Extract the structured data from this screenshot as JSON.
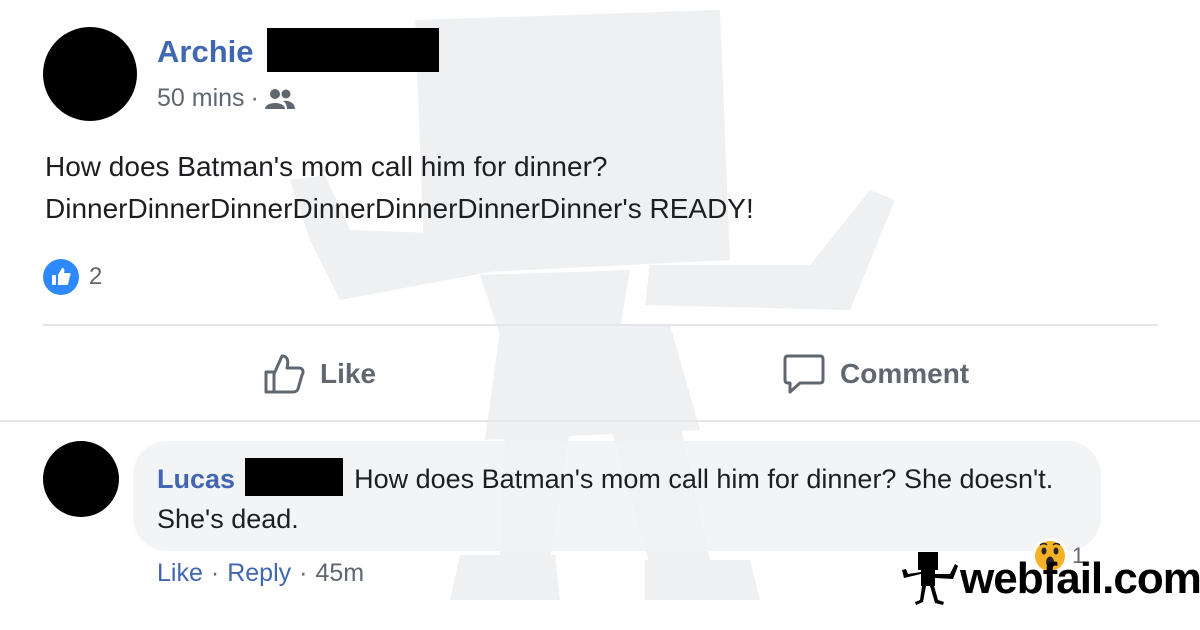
{
  "post": {
    "author": "Archie",
    "time": "50 mins",
    "dot": "·",
    "audience_icon": "friends-icon",
    "text_lines": [
      "How does Batman's mom call him for dinner?",
      "DinnerDinnerDinnerDinnerDinnerDinnerDinner's READY!"
    ],
    "reactions": {
      "icon": "like-reaction-icon",
      "count": "2"
    }
  },
  "actions": {
    "like": "Like",
    "comment": "Comment"
  },
  "comment": {
    "author": "Lucas",
    "text": "How does Batman's mom call him for dinner? She doesn't. She's dead.",
    "like": "Like",
    "reply": "Reply",
    "time": "45m",
    "sep": "·",
    "reaction": {
      "icon": "wow-reaction-icon",
      "count": "1"
    }
  },
  "watermark": {
    "brand": "webfail.com"
  },
  "colors": {
    "accent": "#4267b2",
    "muted": "#606770",
    "like_blue": "#2e89ff",
    "bubble": "#f0f2f5"
  }
}
